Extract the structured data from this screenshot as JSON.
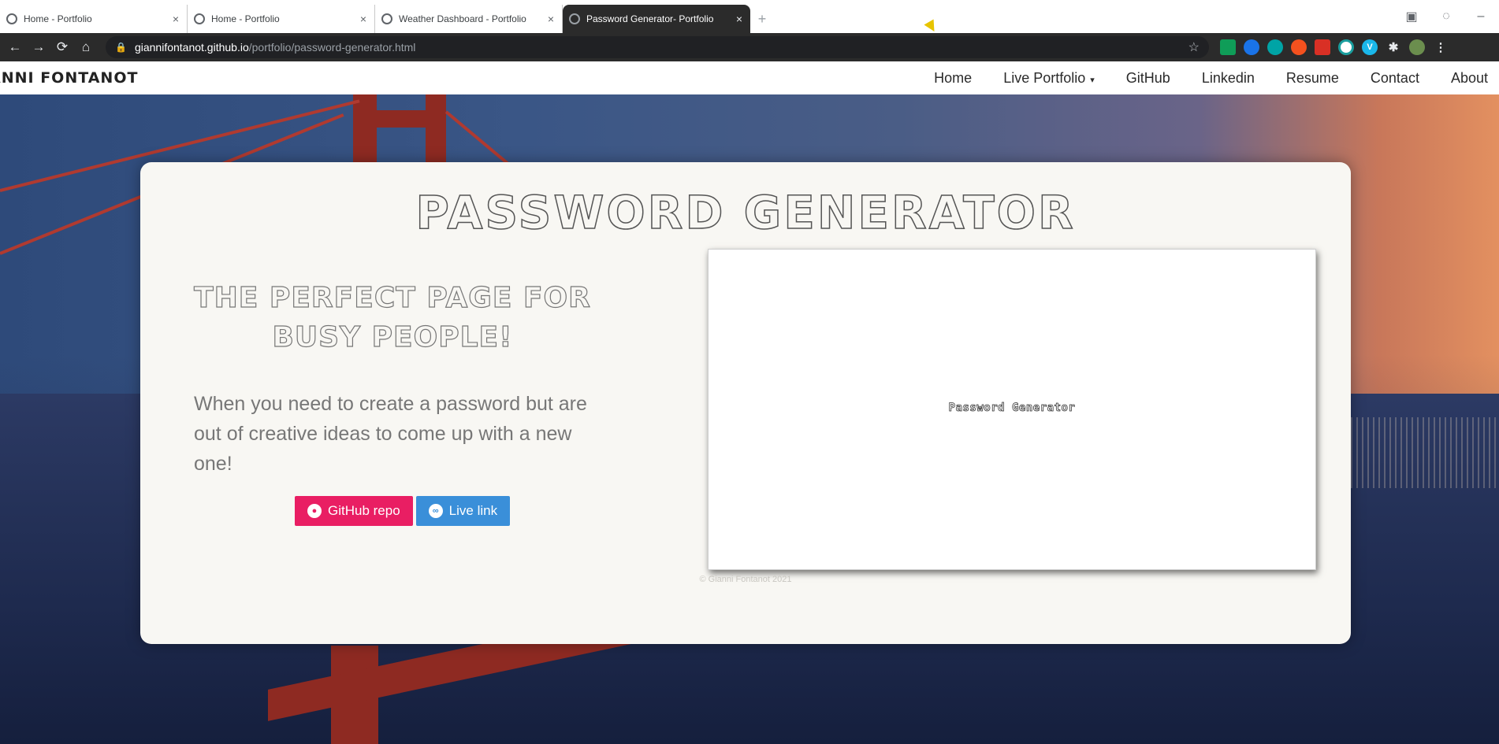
{
  "browser": {
    "tabs": [
      {
        "title": "Home - Portfolio",
        "active": false
      },
      {
        "title": "Home - Portfolio",
        "active": false
      },
      {
        "title": "Weather Dashboard - Portfolio",
        "active": false
      },
      {
        "title": "Password Generator- Portfolio",
        "active": true
      }
    ],
    "tab_close_glyph": "×",
    "new_tab_glyph": "+",
    "url_host": "giannifontanot.github.io",
    "url_path": "/portfolio/password-generator.html",
    "extensions": [
      "sheets",
      "pin",
      "edge",
      "color",
      "flag",
      "circle",
      "vimeo",
      "puzzle",
      "avatar"
    ]
  },
  "site": {
    "brand": "ANNI FONTANOT",
    "nav": {
      "home": "Home",
      "live_portfolio": "Live Portfolio",
      "github": "GitHub",
      "linkedin": "Linkedin",
      "resume": "Resume",
      "contact": "Contact",
      "about": "About"
    }
  },
  "card": {
    "title": "PASSWORD GENERATOR",
    "tagline": "THE PERFECT PAGE FOR BUSY PEOPLE!",
    "description": "When you need to create a password but are out of creative ideas to come up with a new one!",
    "buttons": {
      "github": "GitHub repo",
      "live": "Live link"
    },
    "preview_label": "Password Generator",
    "footer": "© Gianni Fontanot 2021"
  },
  "colors": {
    "github_button": "#e91e63",
    "live_button": "#3a8fd9",
    "card_bg": "#f8f7f3",
    "active_tab": "#2b2b2b"
  }
}
